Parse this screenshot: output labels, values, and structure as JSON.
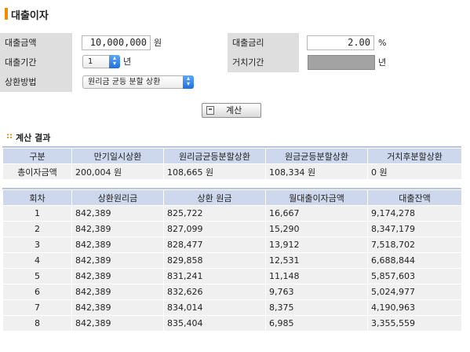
{
  "page": {
    "title": "대출이자"
  },
  "form": {
    "loan_amount": {
      "label": "대출금액",
      "value": "10,000,000",
      "unit": "원"
    },
    "loan_rate": {
      "label": "대출금리",
      "value": "2.00",
      "unit": "%"
    },
    "loan_period": {
      "label": "대출기간",
      "value": "1",
      "unit": "년"
    },
    "grace_period": {
      "label": "거치기간",
      "value": "",
      "unit": "년"
    },
    "repay_method": {
      "label": "상환방법",
      "value": "원리금 균등 분할 상환"
    },
    "calc_button": "계산"
  },
  "results": {
    "section_title": "계산 결과",
    "section_marker": "::",
    "summary": {
      "headers": [
        "구분",
        "만기일시상환",
        "원리금균등분할상환",
        "원금균등분할상환",
        "거치후분할상환"
      ],
      "row": [
        "총이자금액",
        "200,004 원",
        "108,665 원",
        "108,334 원",
        "0 원"
      ]
    },
    "schedule": {
      "headers": [
        "회차",
        "상환원리금",
        "상환 원금",
        "월대출이자금액",
        "대출잔액"
      ],
      "rows": [
        [
          "1",
          "842,389",
          "825,722",
          "16,667",
          "9,174,278"
        ],
        [
          "2",
          "842,389",
          "827,099",
          "15,290",
          "8,347,179"
        ],
        [
          "3",
          "842,389",
          "828,477",
          "13,912",
          "7,518,702"
        ],
        [
          "4",
          "842,389",
          "829,858",
          "12,531",
          "6,688,844"
        ],
        [
          "5",
          "842,389",
          "831,241",
          "11,148",
          "5,857,603"
        ],
        [
          "6",
          "842,389",
          "832,626",
          "9,763",
          "5,024,977"
        ],
        [
          "7",
          "842,389",
          "834,014",
          "8,375",
          "4,190,963"
        ],
        [
          "8",
          "842,389",
          "835,404",
          "6,985",
          "3,355,559"
        ]
      ]
    }
  }
}
